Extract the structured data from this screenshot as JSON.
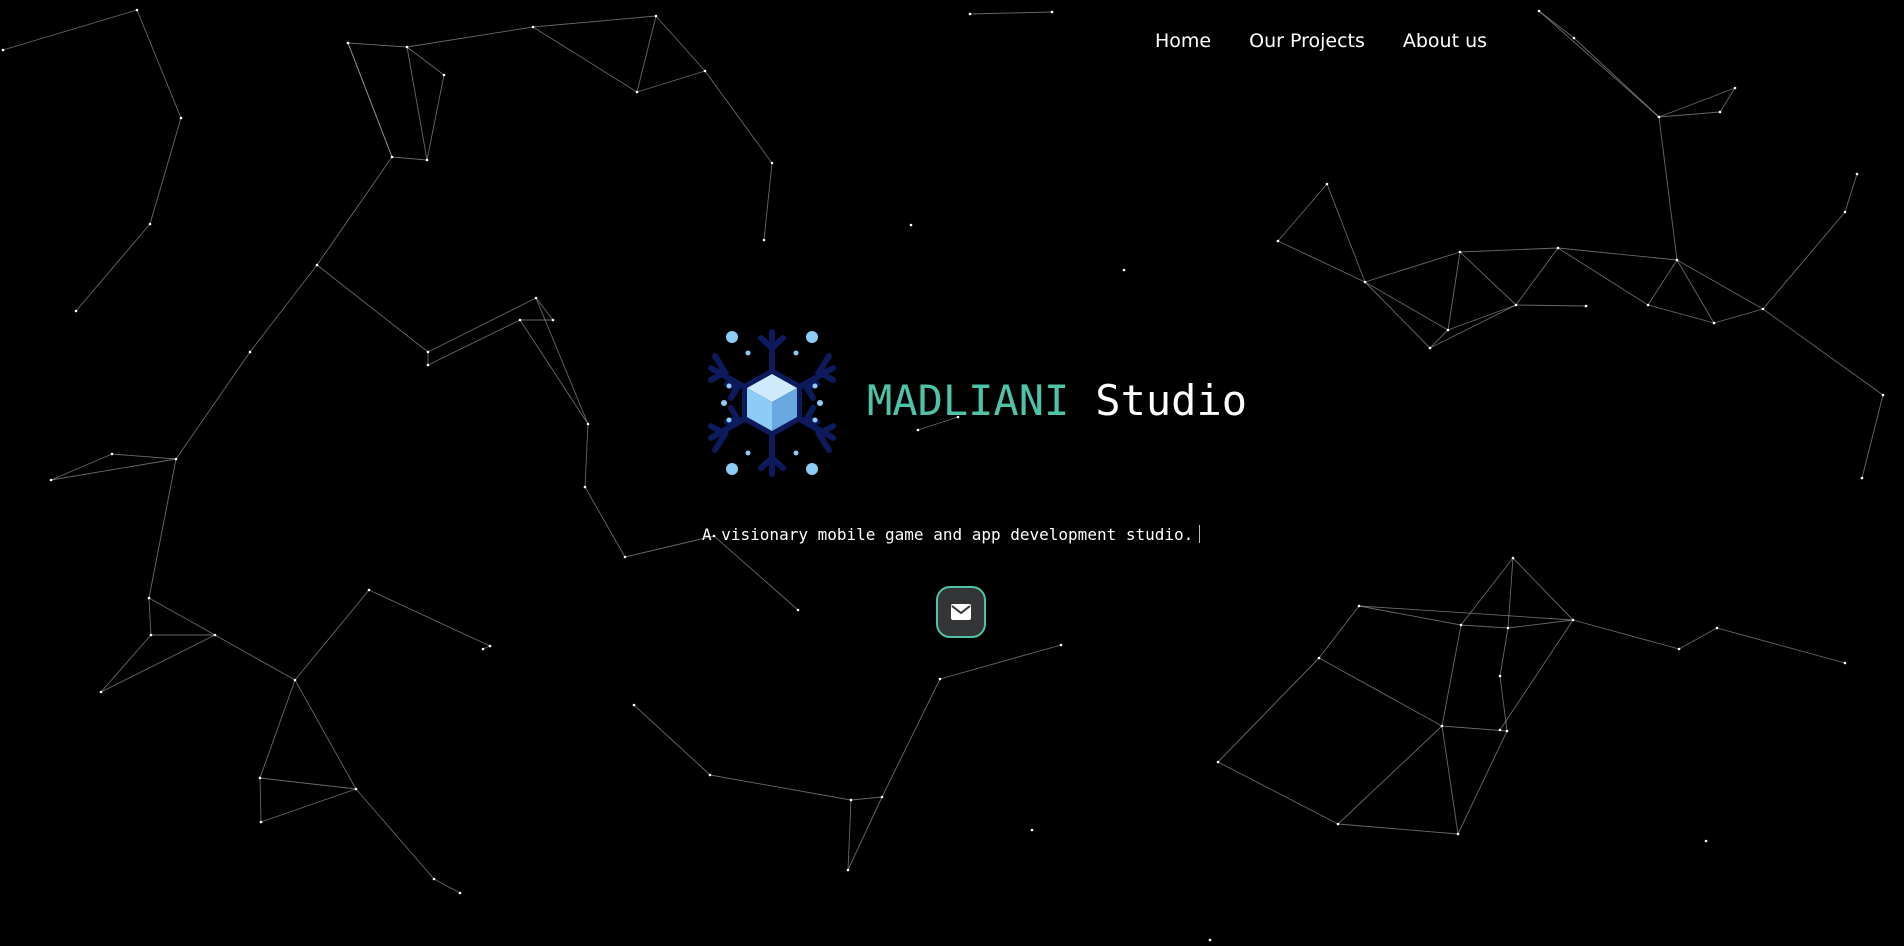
{
  "nav": {
    "home": "Home",
    "projects": "Our Projects",
    "about": "About us"
  },
  "brand": {
    "part1": "MADLIANI",
    "part2": "Studio"
  },
  "tagline": "A visionary mobile game and app development studio.",
  "contact": {
    "icon": "envelope-icon"
  },
  "colors": {
    "background": "#000000",
    "accent": "#4fc3a8",
    "text": "#ffffff",
    "button_bg": "#333537",
    "logo_dark": "#0d1a5c",
    "logo_light": "#8ecbf5"
  }
}
